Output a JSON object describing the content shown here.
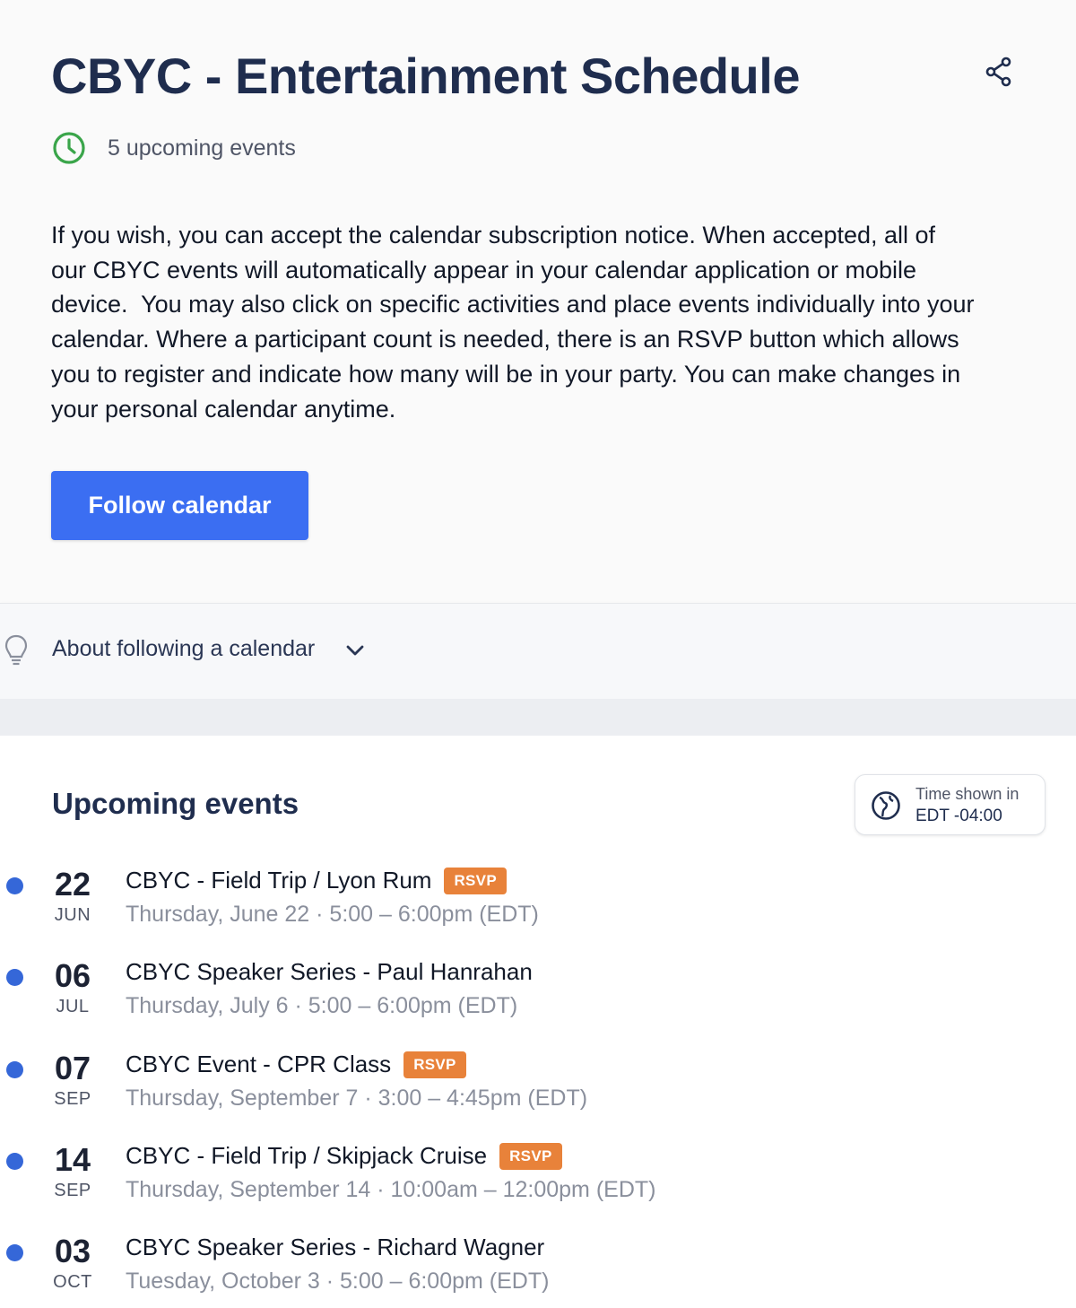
{
  "header": {
    "title": "CBYC - Entertainment Schedule",
    "upcoming_count": "5 upcoming events",
    "description": "If you wish, you can accept the calendar subscription notice. When accepted, all of\nour CBYC events will automatically appear in your calendar application or mobile\ndevice.  You may also click on specific activities and place events individually into your\ncalendar. Where a participant count is needed, there is an RSVP button which allows\nyou to register and indicate how many will be in your party. You can make changes in\nyour personal calendar anytime.",
    "follow_label": "Follow calendar"
  },
  "about": {
    "label": "About following a calendar"
  },
  "events_section": {
    "title": "Upcoming events",
    "tz_line1": "Time shown in",
    "tz_line2": "EDT -04:00"
  },
  "events": [
    {
      "day": "22",
      "month": "JUN",
      "title": "CBYC - Field Trip / Lyon Rum",
      "rsvp": "RSVP",
      "when": "Thursday, June 22 · 5:00 – 6:00pm (EDT)"
    },
    {
      "day": "06",
      "month": "JUL",
      "title": "CBYC Speaker Series - Paul Hanrahan",
      "rsvp": "",
      "when": "Thursday, July 6 · 5:00 – 6:00pm (EDT)"
    },
    {
      "day": "07",
      "month": "SEP",
      "title": "CBYC Event - CPR Class",
      "rsvp": "RSVP",
      "when": "Thursday, September 7 · 3:00 – 4:45pm (EDT)"
    },
    {
      "day": "14",
      "month": "SEP",
      "title": "CBYC - Field Trip / Skipjack Cruise",
      "rsvp": "RSVP",
      "when": "Thursday, September 14 · 10:00am – 12:00pm (EDT)"
    },
    {
      "day": "03",
      "month": "OCT",
      "title": "CBYC Speaker Series - Richard Wagner",
      "rsvp": "",
      "when": "Tuesday, October 3 · 5:00 – 6:00pm (EDT)"
    }
  ],
  "icons": {
    "share": "share-icon",
    "clock": "clock-icon",
    "bulb": "lightbulb-icon",
    "chevron": "chevron-down-icon",
    "globe": "globe-icon"
  },
  "colors": {
    "accent": "#3b6ef2",
    "rsvp": "#e8823a",
    "dot": "#3567d8",
    "clock": "#3aa54a"
  }
}
